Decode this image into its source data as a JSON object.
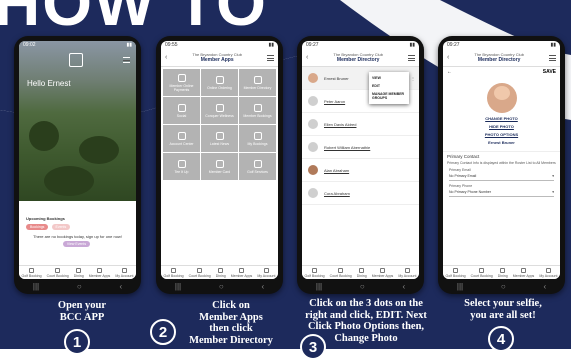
{
  "headline": "HOW TO",
  "colors": {
    "navy": "#1d2a5c",
    "white": "#ffffff",
    "accent_pink": "#e88a8a"
  },
  "steps": [
    {
      "num": "1",
      "caption_lines": [
        "Open your",
        "BCC APP"
      ]
    },
    {
      "num": "2",
      "caption_lines": [
        "Click on",
        "Member Apps",
        "then click",
        "Member Directory"
      ]
    },
    {
      "num": "3",
      "caption_lines": [
        "Click on the 3 dots on the",
        "right and click, EDIT. Next",
        "Click Photo Options then,",
        "Change Photo"
      ]
    },
    {
      "num": "4",
      "caption_lines": [
        "Select your selfie,",
        "you are all set!"
      ]
    }
  ],
  "phone1": {
    "status_time": "09:02",
    "greeting": "Hello Ernest",
    "bookings_title": "Upcoming Bookings",
    "btn_a": "Bookings",
    "btn_b": "Events",
    "empty_text": "There are no bookings today, sign up for one now!",
    "cta": "View Events"
  },
  "phone2": {
    "status_time": "09:55",
    "club": "The Bryandon Country Club",
    "title": "Member Apps",
    "tiles": [
      "Member Online Payments",
      "Online Ordering",
      "Member Directory",
      "Social",
      "Conquer Wellness",
      "Member Bookings",
      "Account Center",
      "Latest News",
      "My Bookings",
      "Tee It Up",
      "Member Card",
      "Golf Services"
    ]
  },
  "phone3": {
    "status_time": "09:27",
    "club": "The Bryandon Country Club",
    "title": "Member Directory",
    "menu_items": [
      "VIEW",
      "EDIT",
      "MANAGE MEMBER GROUPS"
    ],
    "members": [
      "Ernest Bruner",
      "Peter Aaron",
      "Ellen Davis Aldred",
      "Robert William Abernathie",
      "Alan Abraham",
      "Cora Abraham"
    ]
  },
  "phone4": {
    "status_time": "09:27",
    "club": "The Bryandon Country Club",
    "title": "Member Directory",
    "save": "SAVE",
    "change_photo": "CHANGE PHOTO",
    "hide_photo": "HIDE PHOTO",
    "photo_options": "PHOTO OPTIONS",
    "member_name": "Ernest Bruner",
    "section": "Primary Contact",
    "note": "Primary Contact Info is displayed within the Roster List to All Members",
    "email_label": "Primary Email",
    "email_value": "No Primary Email",
    "phone_label": "Primary Phone",
    "phone_value": "No Primary Phone Number"
  },
  "tabs": [
    "Golf Booking",
    "Court Booking",
    "Dining",
    "Member Apps",
    "My Account"
  ]
}
